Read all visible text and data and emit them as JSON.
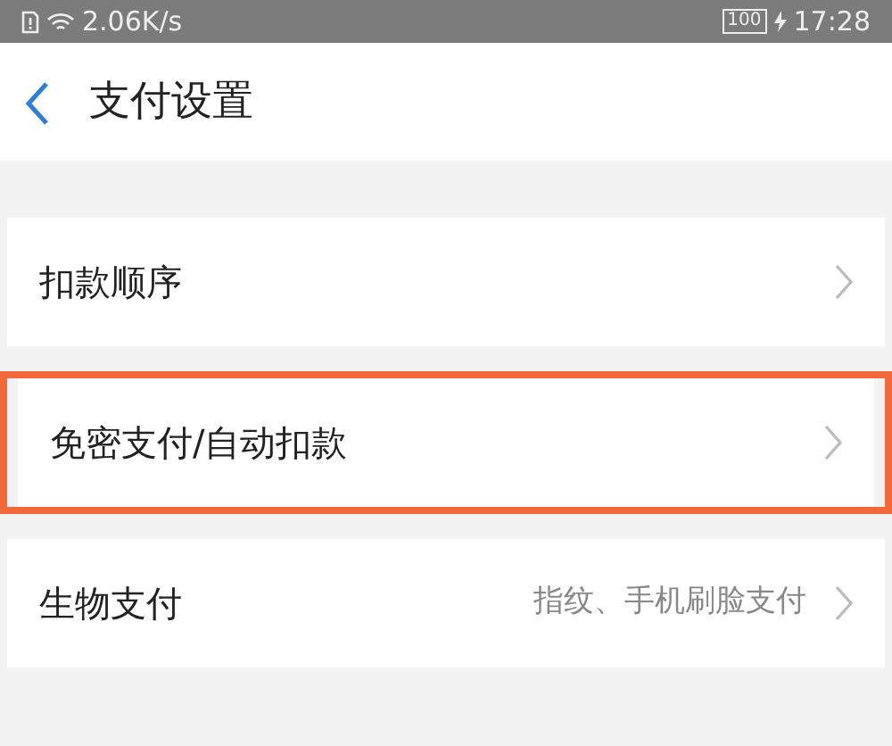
{
  "status_bar": {
    "speed": "2.06K/s",
    "battery": "100",
    "time": "17:28"
  },
  "header": {
    "title": "支付设置"
  },
  "items": [
    {
      "label": "扣款顺序",
      "highlighted": false
    },
    {
      "label": "免密支付/自动扣款",
      "highlighted": true
    },
    {
      "label": "生物支付",
      "value": "指纹、手机刷脸支付",
      "highlighted": false
    }
  ]
}
